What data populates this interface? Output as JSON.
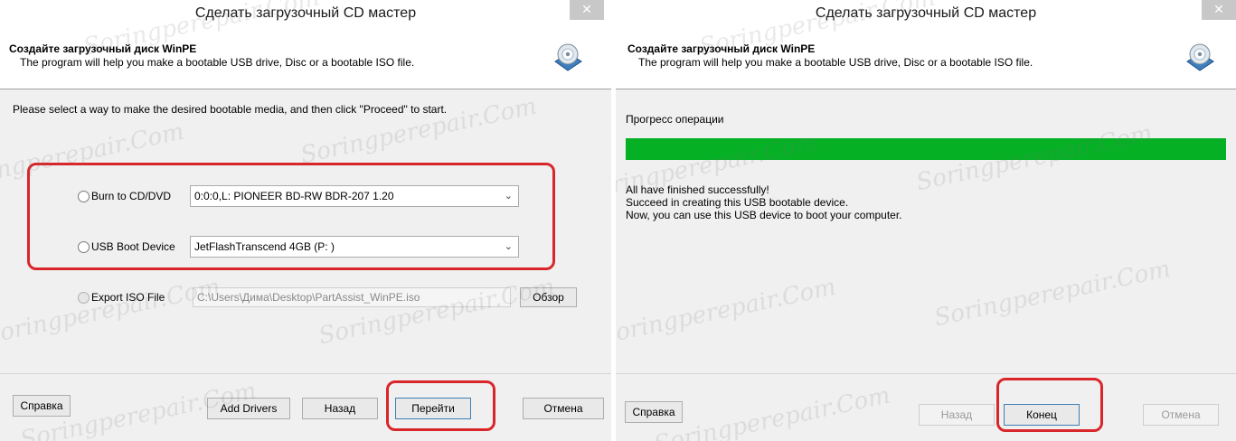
{
  "left": {
    "window_title": "Сделать загрузочный CD мастер",
    "close_symbol": "✕",
    "header_title": "Создайте загрузочный диск WinPE",
    "header_subtitle": "The program will help you make a bootable USB drive, Disc or a bootable ISO file.",
    "instruction": "Please select a way to make the desired bootable media, and then click \"Proceed\" to start.",
    "options": [
      {
        "label": "Burn to CD/DVD",
        "value": "0:0:0,L: PIONEER  BD-RW   BDR-207  1.20"
      },
      {
        "label": "USB Boot Device",
        "value": "JetFlashTranscend 4GB    (P: )"
      },
      {
        "label": "Export ISO File",
        "value": "C:\\Users\\Дима\\Desktop\\PartAssist_WinPE.iso"
      }
    ],
    "browse_label": "Обзор",
    "buttons": {
      "help": "Справка",
      "add_drivers": "Add Drivers",
      "back": "Назад",
      "proceed": "Перейти",
      "cancel": "Отмена"
    }
  },
  "right": {
    "window_title": "Сделать загрузочный CD мастер",
    "close_symbol": "✕",
    "header_title": "Создайте загрузочный диск WinPE",
    "header_subtitle": "The program will help you make a bootable USB drive, Disc or a bootable ISO file.",
    "progress_label": "Прогресс операции",
    "progress": 1.0,
    "messages": [
      "All have finished successfully!",
      "Succeed in creating this USB bootable device.",
      "Now, you can use this USB device to boot your computer."
    ],
    "buttons": {
      "help": "Справка",
      "back": "Назад",
      "finish": "Конец",
      "cancel": "Отмена"
    }
  },
  "watermark": "Soringperepair.Com",
  "colors": {
    "highlight": "#d9262b",
    "progress": "#06b025"
  },
  "icons": {
    "dropdown": "chevron-down-icon",
    "disc": "disc-icon"
  },
  "chevron_symbol": "⌄"
}
